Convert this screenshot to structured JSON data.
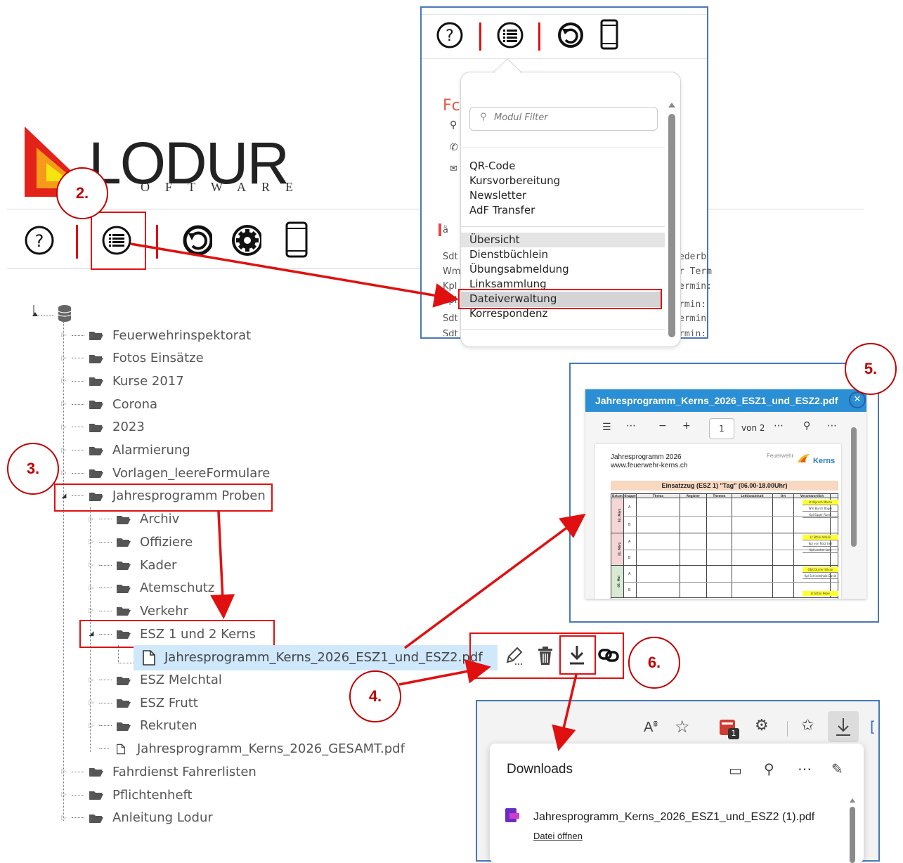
{
  "logo": {
    "word": "LODUR",
    "sub": "OFTWARE"
  },
  "steps": {
    "s2": "2.",
    "s3": "3.",
    "s4": "4.",
    "s5": "5.",
    "s6": "6."
  },
  "menu": {
    "filter_placeholder": "Modul Filter",
    "group1": [
      "QR-Code",
      "Kursvorbereitung",
      "Newsletter",
      "AdF Transfer"
    ],
    "group2": [
      "Übersicht",
      "Dienstbüchlein",
      "Übungsabmeldung",
      "Linksammlung",
      "Dateiverwaltung",
      "Korrespondenz"
    ],
    "behind_left": [
      "Fc",
      "ä",
      "Sdt",
      "Wm",
      "Kpl",
      "Kpl",
      "Sdt",
      "Sdt"
    ],
    "behind_right": [
      "ederb",
      "r Term",
      "ermin:",
      "rmin:",
      "ermin",
      "rmin:"
    ]
  },
  "tree": {
    "root_folders": [
      "Feuerwehrinspektorat",
      "Fotos Einsätze",
      "Kurse 2017",
      "Corona",
      "2023",
      "Alarmierung",
      "Vorlagen_leereFormulare",
      "Jahresprogramm Proben"
    ],
    "sub_folders": [
      "Archiv",
      "Offiziere",
      "Kader",
      "Atemschutz",
      "Verkehr",
      "ESZ 1 und 2 Kerns"
    ],
    "selected_file": "Jahresprogramm_Kerns_2026_ESZ1_und_ESZ2.pdf",
    "sub_folders2": [
      "ESZ Melchtal",
      "ESZ Frutt",
      "Rekruten"
    ],
    "sub_file": "Jahresprogramm_Kerns_2026_GESAMT.pdf",
    "root_folders2": [
      "Fahrdienst Fahrerlisten",
      "Pflichtenheft",
      "Anleitung Lodur"
    ]
  },
  "pdf": {
    "title": "Jahresprogramm_Kerns_2026_ESZ1_und_ESZ2.pdf",
    "page": "1",
    "page_of": "von 2",
    "doc_title": "Jahresprogramm 2026",
    "doc_url": "www.feuerwehr-kerns.ch",
    "brand_small": "Feuerwehr",
    "brand_big": "Kerns",
    "table_title": "Einsatzzug (ESZ 1) \"Tag\" (06.00-18.00Uhr)",
    "headers": [
      "Datum",
      "Gruppe",
      "Thema",
      "Register",
      "Themen",
      "Lektionsinhalt",
      "Ort",
      "Verantwortlich"
    ],
    "dates": [
      "03. März",
      "31. März",
      "05. Mai"
    ],
    "resp": [
      "Lt Wyrsch Marco",
      "Wm Burch Roger",
      "Kpl Egger Ruedi",
      "Lt Ettlin Adrian",
      "Kpl von Rotz Ueli",
      "Kpl Lischer Lars",
      "Oblt Durrer Silvan",
      "Kpl Schindelholz David",
      "Lt Ettlin Peter"
    ]
  },
  "downloads": {
    "title": "Downloads",
    "file": "Jahresprogramm_Kerns_2026_ESZ1_und_ESZ2 (1).pdf",
    "open": "Datei öffnen",
    "badge": "1"
  },
  "colors": {
    "accent_red": "#e01010",
    "step_red": "#c00000",
    "panel_blue": "#4a78b8",
    "pdf_bar": "#2a8fd4",
    "select_bg": "#cfe8fb"
  }
}
